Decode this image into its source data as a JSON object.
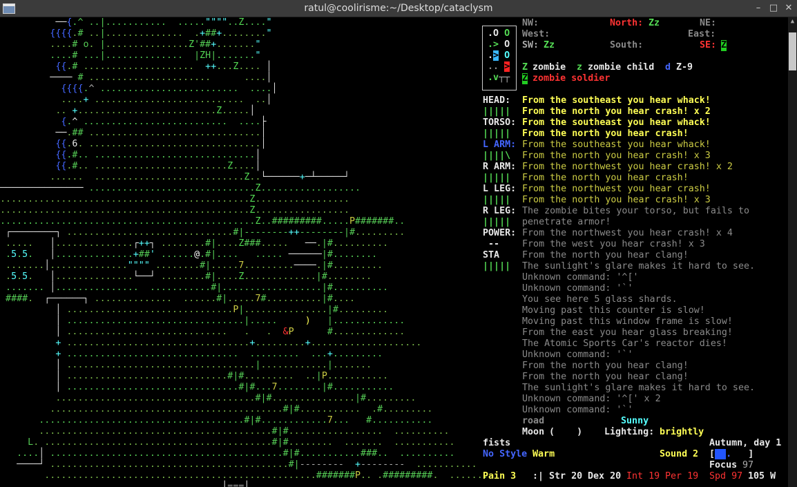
{
  "window": {
    "title": "ratul@coolirisme:~/Desktop/cataclysm",
    "minimize_glyph": "–",
    "maximize_glyph": "□",
    "close_glyph": "✕"
  },
  "compass": {
    "nw": "NW:",
    "north_label": "North:",
    "north_value": "Zz",
    "ne": "NE:",
    "west": "West:",
    "east": "East:",
    "sw_label": "SW:",
    "sw_value": "Zz",
    "south": "South:",
    "se_label": "SE:",
    "se_value": "Z"
  },
  "monster_legend": {
    "zombie_glyph": "Z",
    "zombie_label": "zombie",
    "child_glyph": "z",
    "child_label": "zombie child",
    "z9_glyph": "d",
    "z9_label": "Z-9",
    "soldier_glyph": "Z",
    "soldier_label": "zombie soldier"
  },
  "body": [
    {
      "part": "HEAD:",
      "bar": "|||||"
    },
    {
      "part": "TORSO:",
      "bar": "|||||"
    },
    {
      "part": "L ARM:",
      "bar": "||||\\"
    },
    {
      "part": "R ARM:",
      "bar": "|||||"
    },
    {
      "part": "L LEG:",
      "bar": "|||||"
    },
    {
      "part": "R LEG:",
      "bar": "|||||"
    }
  ],
  "power_label": "POWER:",
  "power_value": "--",
  "sta_label": "STA",
  "sta_bar": "|||||",
  "messages": [
    "From the southeast you hear whack!",
    "From the north you hear crash! x 2",
    "From the southeast you hear whack!",
    "From the north you hear crash!",
    "From the southeast you hear whack!",
    "From the north you hear crash! x 3",
    "From the northwest you hear crash! x 2",
    "From the north you hear crash!",
    "From the northwest you hear crash!",
    "From the north you hear crash! x 3",
    "The zombie bites your torso, but fails to",
    "penetrate armor!",
    "From the northwest you hear crash! x 4",
    "From the west you hear crash! x 3",
    "From the north you hear clang!",
    "The sunlight's glare makes it hard to see.",
    "Unknown command: '^['",
    "Unknown command: '`'",
    "You see here 5 glass shards.",
    "Moving past this counter is slow!",
    "Moving past this window frame is slow!",
    "From the east you hear glass breaking!",
    "The Atomic Sports Car's reactor dies!",
    "Unknown command: '`'",
    "From the north you hear clang!",
    "From the north you hear clang!",
    "The sunlight's glare makes it hard to see.",
    "Unknown command: '^[' x 2",
    "Unknown command: '`'"
  ],
  "status": {
    "terrain": "road",
    "weather": "Sunny",
    "moon_label": "Moon",
    "moon_value": "(    )",
    "lighting_label": "Lighting:",
    "lighting_value": "brightly",
    "weapon": "fists",
    "season": "Autumn, day 1",
    "style": "No Style",
    "temperature": "Warm",
    "sound_label": "Sound",
    "sound_value": "2",
    "focus_label": "Focus",
    "focus_value": "97",
    "pain": "Pain 3",
    "face": ":|",
    "str": "Str 20",
    "dex": "Dex 20",
    "int": "Int 19",
    "per": "Per 19",
    "spd": "Spd 97",
    "move": "105 W"
  },
  "map_rows": [
    "          ──{.^ ..|...........  .....\"\"\"\"..Z....\"",
    "         {{{{.# ..|..............  .+##+........\"",
    "         ....# o. |...............Z'##+.......\"",
    "         ....# ...|..............  |ZH|.......\"",
    "          {{.# ....................  ++...Z.... │",
    "         ──── # ......................      ....│",
    "           {{{{.^ .........................  ....│",
    "           ....+ ...........................  ..│",
    "          .. +.........................Z.....│",
    "           {.^ ..........................  ....├",
    "          ──.## ...............................│",
    "          {{.6. ...............................│",
    "          {{.#.. .............................│",
    "          {{.#.. ........................Z....│",
    "         ......  ...........................Z..└──────+─┴─────┘",
    "─────────────── ..............................Z..................",
    ".............................................Z.................",
    ".............................................Z.................",
    "..............................................Z..#########.....P#######..",
    " ┌────────┐ ..............................#|--------++--------|#.........",
    " .....   │..............┌++┐ ........#|....Z###.....   ──.|#..........",
    " .5.5.   │..............+##' ......@.#|....   ..... ──────|#........",
    " .......│..............\"\"\"\" ........#|.....7.........────.|#.........",
    " .5.5.   │..............└──┘ ........#|....Z.............|#........",
    " ....... │...............  ...........#|..................|#..........",
    " ####.  ┌──────┐ ..............  ......#|.....7#..........|#....",
    "          │ ..............................P|...............|#.........",
    "          │ ................................|.....     )   |.............",
    "          │ .............................   .   .  &P      #.............",
    "          + .................................+.........+....................",
    "          + ...............................  .........  ...+.........",
    "          │ ..................................|............|.......",
    "          │ .............................#|#.........  ..|P...........",
    "          │ ...............................#|#...7........|#...........",
    "          ....................................#|#...............|#.........",
    "         ..........................................#|#...........  .#.........",
    "       .....................................#|#............7...   #...........",
    "       ..........................................#|#.................  ..........",
    "     L. .........................................#|#........  .......  ...........",
    "   ....│ ..........................................#|#...........###..  ..........",
    "   ────┘ ...........................................#|--------  +--------  ...........",
    "        .................................................#######P.. .#########.  .......",
    "       ...............................  │===│ .................  .......  ..  .........."
  ],
  "map_palette": [
    "g",
    "gy",
    "w",
    "dim",
    "g",
    "c",
    "y",
    "lr",
    "b"
  ]
}
